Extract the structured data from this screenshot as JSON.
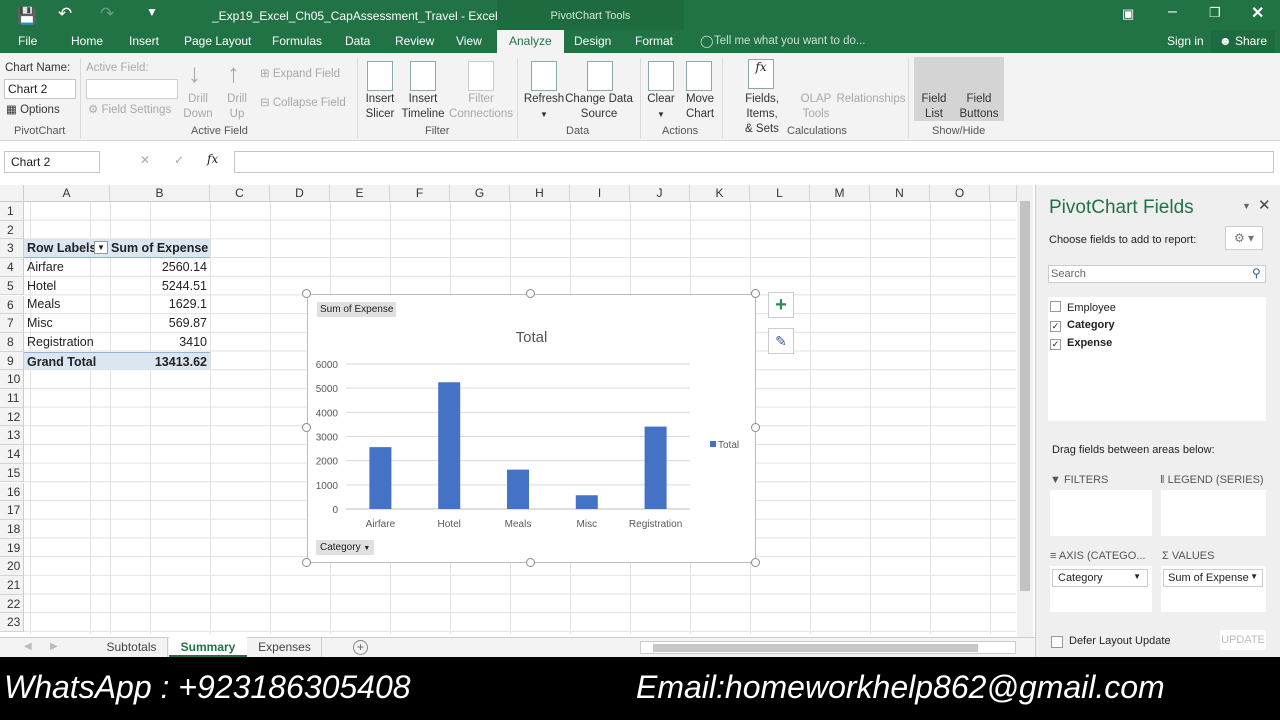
{
  "title_bar": {
    "file_title": "_Exp19_Excel_Ch05_CapAssessment_Travel - Excel",
    "context_tab": "PivotChart Tools",
    "sign_in": "Sign in",
    "share": "Share",
    "tell_me": "Tell me what you want to do..."
  },
  "tabs": [
    "File",
    "Home",
    "Insert",
    "Page Layout",
    "Formulas",
    "Data",
    "Review",
    "View",
    "Analyze",
    "Design",
    "Format"
  ],
  "active_tab": "Analyze",
  "ribbon": {
    "pivotchart": {
      "chart_name_label": "Chart Name:",
      "chart_name_value": "Chart 2",
      "options": "Options",
      "group": "PivotChart"
    },
    "active_field": {
      "label": "Active Field:",
      "value": "",
      "field_settings": "Field Settings",
      "drill_down": [
        "Drill",
        "Down"
      ],
      "drill_up": [
        "Drill",
        "Up"
      ],
      "expand": "Expand Field",
      "collapse": "Collapse Field",
      "group": "Active Field"
    },
    "filter": {
      "insert_slicer": [
        "Insert",
        "Slicer"
      ],
      "insert_timeline": [
        "Insert",
        "Timeline"
      ],
      "filter_connections": [
        "Filter",
        "Connections"
      ],
      "group": "Filter"
    },
    "data": {
      "refresh": "Refresh",
      "change_source": [
        "Change Data",
        "Source"
      ],
      "group": "Data"
    },
    "actions": {
      "clear": "Clear",
      "move_chart": [
        "Move",
        "Chart"
      ],
      "group": "Actions"
    },
    "calculations": {
      "fields_items": [
        "Fields, Items,",
        "& Sets"
      ],
      "olap": [
        "OLAP",
        "Tools"
      ],
      "relationships": "Relationships",
      "group": "Calculations"
    },
    "show_hide": {
      "field_list": [
        "Field",
        "List"
      ],
      "field_buttons": [
        "Field",
        "Buttons"
      ],
      "group": "Show/Hide"
    }
  },
  "name_box": "Chart 2",
  "formula": "",
  "columns": [
    "A",
    "B",
    "C",
    "D",
    "E",
    "F",
    "G",
    "H",
    "I",
    "J",
    "K",
    "L",
    "M",
    "N",
    "O"
  ],
  "rows": [
    "1",
    "2",
    "3",
    "4",
    "5",
    "6",
    "7",
    "8",
    "9",
    "10",
    "11",
    "12",
    "13",
    "14",
    "15",
    "16",
    "17",
    "18",
    "19",
    "20",
    "21",
    "22",
    "23"
  ],
  "pivot_table": {
    "header": [
      "Row Labels",
      "Sum of Expense"
    ],
    "rows": [
      [
        "Airfare",
        "2560.14"
      ],
      [
        "Hotel",
        "5244.51"
      ],
      [
        "Meals",
        "1629.1"
      ],
      [
        "Misc",
        "569.87"
      ],
      [
        "Registration",
        "3410"
      ]
    ],
    "total": [
      "Grand Total",
      "13413.62"
    ]
  },
  "chart_data": {
    "type": "bar",
    "title": "Total",
    "categories": [
      "Airfare",
      "Hotel",
      "Meals",
      "Misc",
      "Registration"
    ],
    "series": [
      {
        "name": "Total",
        "values": [
          2560.14,
          5244.51,
          1629.1,
          569.87,
          3410
        ],
        "color": "#4472c4"
      }
    ],
    "ylim": [
      0,
      6000
    ],
    "yticks": [
      "0",
      "1000",
      "2000",
      "3000",
      "4000",
      "5000",
      "6000"
    ],
    "grid": true,
    "legend": "right",
    "value_button": "Sum of Expense",
    "axis_button": "Category"
  },
  "sheets": {
    "tabs": [
      "Subtotals",
      "Summary",
      "Expenses"
    ],
    "active": "Summary"
  },
  "pane": {
    "title": "PivotChart Fields",
    "subtitle": "Choose fields to add to report:",
    "search_placeholder": "Search",
    "fields": [
      {
        "name": "Employee",
        "checked": false
      },
      {
        "name": "Category",
        "checked": true
      },
      {
        "name": "Expense",
        "checked": true
      }
    ],
    "drag_text": "Drag fields between areas below:",
    "filters": "FILTERS",
    "legend": "LEGEND (SERIES)",
    "axis": "AXIS (CATEGO...",
    "values": "VALUES",
    "axis_item": "Category",
    "values_item": "Sum of Expense",
    "defer": "Defer Layout Update",
    "update": "UPDATE"
  },
  "overlay": {
    "whatsapp": "WhatsApp : +923186305408",
    "email": "Email:homeworkhelp862@gmail.com"
  },
  "colors": {
    "excel_green": "#217346",
    "bar": "#4472c4"
  }
}
